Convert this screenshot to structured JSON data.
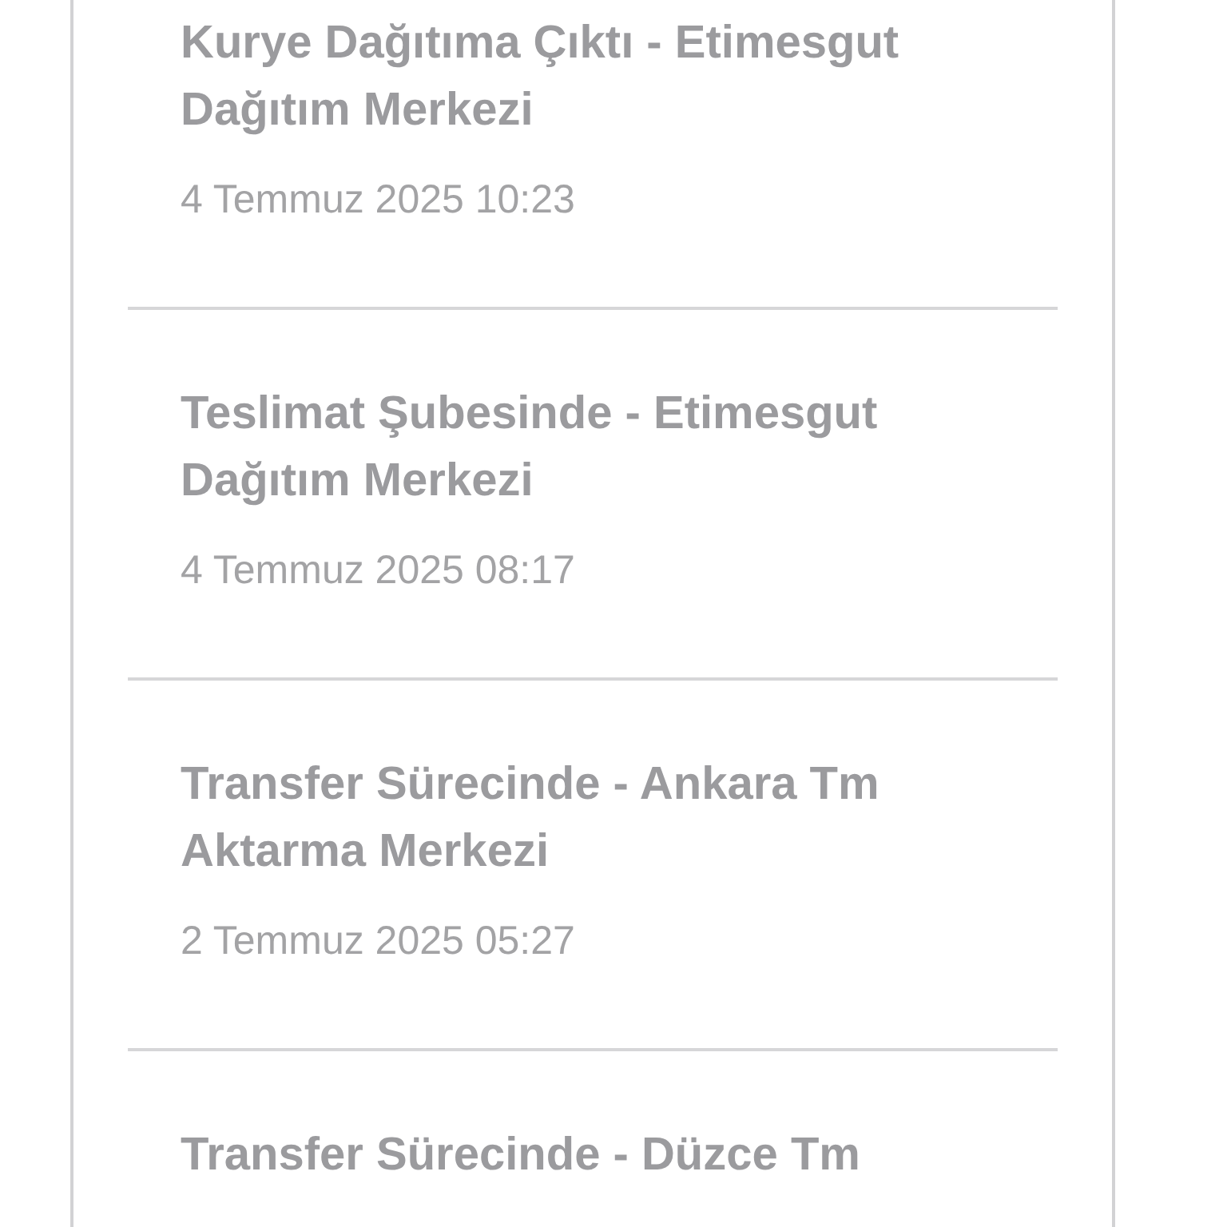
{
  "events": [
    {
      "title": "Kurye Dağıtıma Çıktı - Etimesgut Dağıtım Merkezi",
      "date": "4 Temmuz 2025 10:23"
    },
    {
      "title": "Teslimat Şubesinde - Etimesgut Dağıtım Merkezi",
      "date": "4 Temmuz 2025 08:17"
    },
    {
      "title": "Transfer Sürecinde - Ankara Tm Aktarma Merkezi",
      "date": "2 Temmuz 2025 05:27"
    },
    {
      "title": "Transfer Sürecinde - Düzce Tm"
    }
  ]
}
